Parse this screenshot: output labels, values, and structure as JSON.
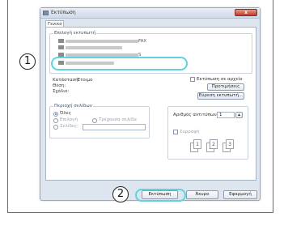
{
  "dialog": {
    "title": "Εκτύπωση",
    "close_label": "x",
    "tab_label": "Γενικό"
  },
  "printer_group": {
    "title": "Επιλογή εκτυπωτή",
    "items": [
      {
        "suffix": "FAX"
      },
      {
        "suffix": "S"
      }
    ]
  },
  "status": {
    "state_label": "Κατάσταση:",
    "state_value": "Έτοιμο",
    "location_label": "Θέση:",
    "comment_label": "Σχόλιο:"
  },
  "print_to_file": {
    "label": "Εκτύπωση σε αρχείο",
    "preferences_button": "Προτιμήσεις",
    "find_printer_button": "Εύρεση εκτυπωτή..."
  },
  "page_range": {
    "title": "Περιοχή σελίδων",
    "all_label": "Όλες",
    "selection_label": "Επιλογή",
    "current_page_label": "Τρέχουσα σελίδα",
    "pages_label": "Σελίδες:"
  },
  "copies": {
    "label": "Αριθμός αντιτύπων:",
    "value": "1",
    "collate_label": "Συρραφή",
    "pages": [
      "1",
      "1",
      "2",
      "2",
      "3",
      "3"
    ]
  },
  "buttons": {
    "print": "Εκτύπωση",
    "cancel": "Άκυρο",
    "apply": "Εφαρμογή"
  },
  "callouts": {
    "one": "1",
    "two": "2"
  }
}
